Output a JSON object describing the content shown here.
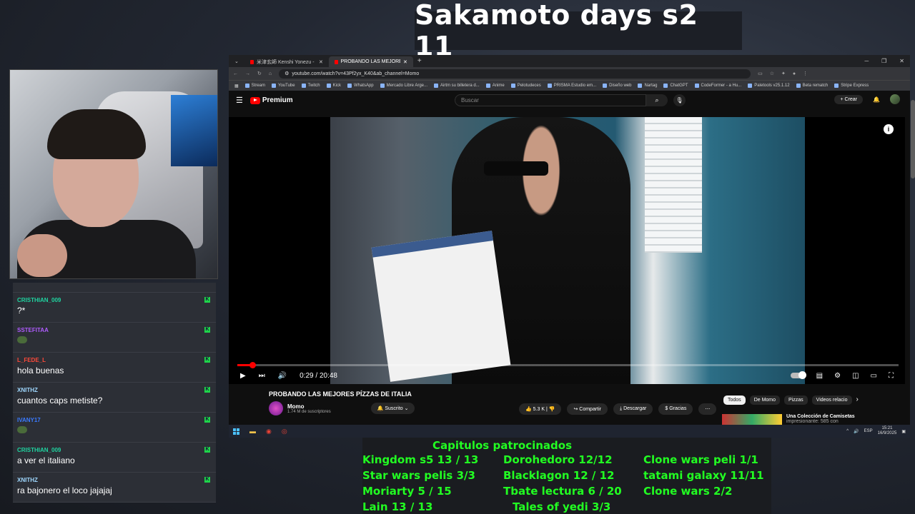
{
  "stream_title": "Sakamoto days s2 11",
  "chat": {
    "messages": [
      {
        "user": "CRISTHIAN_009",
        "text": "?*",
        "color": "#1fd4a0",
        "emote": false
      },
      {
        "user": "SSTEFITAA",
        "text": "",
        "color": "#b05cff",
        "emote": true
      },
      {
        "user": "L_FEDE_L",
        "text": "hola buenas",
        "color": "#ff4a3a",
        "emote": false
      },
      {
        "user": "XNITHZ",
        "text": "cuantos caps metiste?",
        "color": "#9fd8ff",
        "emote": false
      },
      {
        "user": "IVANY17",
        "text": "",
        "color": "#3a7bff",
        "emote": true
      },
      {
        "user": "CRISTHIAN_009",
        "text": "a ver el italiano",
        "color": "#1fd4a0",
        "emote": false
      },
      {
        "user": "XNITHZ",
        "text": "ra bajonero el loco jajajaj",
        "color": "#9fd8ff",
        "emote": false
      }
    ]
  },
  "browser": {
    "tabs": [
      {
        "label": "米津玄師 Kenshi Yonezu - IRIS",
        "active": false
      },
      {
        "label": "PROBANDO LAS MEJORES PÍZZ",
        "active": true
      }
    ],
    "new_tab": "+",
    "url": "youtube.com/watch?v=43Pf2yx_K40&ab_channel=Momo",
    "bookmarks": [
      "Stream",
      "YouTube",
      "Twitch",
      "Kick",
      "WhatsApp",
      "Mercado Libre Arge...",
      "Airtm su billetera d...",
      "Anime",
      "Pelotudeces",
      "PRISMA Estudio em...",
      "Diseño web",
      "Nartag",
      "ChatGPT",
      "CodeFormer - a Hu...",
      "Paletools v25.1.12",
      "Beta rematch",
      "Stripe Express"
    ]
  },
  "youtube": {
    "logo": "Premium",
    "search_placeholder": "Buscar",
    "create_label": "Crear",
    "player": {
      "current_time": "0:29",
      "duration": "20:48",
      "progress_fraction": 0.023
    },
    "video_title": "PROBANDO LAS MEJORES PÍZZAS DE ITALIA",
    "channel_name": "Momo",
    "subscribers": "1.74 M de suscriptores",
    "subscribed_label": "Suscrito",
    "likes": "5.3 K",
    "share_label": "Compartir",
    "download_label": "Descargar",
    "thanks_label": "Gracias",
    "chips": [
      "Todos",
      "De Momo",
      "Pizzas",
      "Videos relacio"
    ],
    "rec_title": "Una Colección de Camisetas",
    "rec_sub": "impresionante: 585 con"
  },
  "taskbar": {
    "lang": "ESP",
    "time": "15:21",
    "date": "16/9/2025"
  },
  "chapters": {
    "heading": "Capitulos patrocinados",
    "items": [
      "Kingdom s5 13 / 13",
      "Dorohedoro 12/12",
      "Clone wars peli 1/1",
      "Star wars pelis 3/3",
      "Blacklagon 12 / 12",
      "tatami galaxy 11/11",
      "Moriarty 5 / 15",
      "Tbate lectura 6 / 20",
      "Clone wars 2/2",
      "Lain 13 / 13",
      "Tales of yedi 3/3"
    ]
  }
}
